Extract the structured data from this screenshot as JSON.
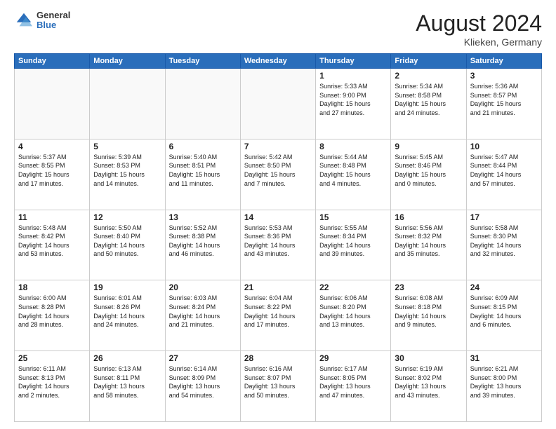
{
  "header": {
    "logo_general": "General",
    "logo_blue": "Blue",
    "month_title": "August 2024",
    "location": "Klieken, Germany"
  },
  "days_of_week": [
    "Sunday",
    "Monday",
    "Tuesday",
    "Wednesday",
    "Thursday",
    "Friday",
    "Saturday"
  ],
  "weeks": [
    [
      {
        "day": "",
        "text": ""
      },
      {
        "day": "",
        "text": ""
      },
      {
        "day": "",
        "text": ""
      },
      {
        "day": "",
        "text": ""
      },
      {
        "day": "1",
        "text": "Sunrise: 5:33 AM\nSunset: 9:00 PM\nDaylight: 15 hours\nand 27 minutes."
      },
      {
        "day": "2",
        "text": "Sunrise: 5:34 AM\nSunset: 8:58 PM\nDaylight: 15 hours\nand 24 minutes."
      },
      {
        "day": "3",
        "text": "Sunrise: 5:36 AM\nSunset: 8:57 PM\nDaylight: 15 hours\nand 21 minutes."
      }
    ],
    [
      {
        "day": "4",
        "text": "Sunrise: 5:37 AM\nSunset: 8:55 PM\nDaylight: 15 hours\nand 17 minutes."
      },
      {
        "day": "5",
        "text": "Sunrise: 5:39 AM\nSunset: 8:53 PM\nDaylight: 15 hours\nand 14 minutes."
      },
      {
        "day": "6",
        "text": "Sunrise: 5:40 AM\nSunset: 8:51 PM\nDaylight: 15 hours\nand 11 minutes."
      },
      {
        "day": "7",
        "text": "Sunrise: 5:42 AM\nSunset: 8:50 PM\nDaylight: 15 hours\nand 7 minutes."
      },
      {
        "day": "8",
        "text": "Sunrise: 5:44 AM\nSunset: 8:48 PM\nDaylight: 15 hours\nand 4 minutes."
      },
      {
        "day": "9",
        "text": "Sunrise: 5:45 AM\nSunset: 8:46 PM\nDaylight: 15 hours\nand 0 minutes."
      },
      {
        "day": "10",
        "text": "Sunrise: 5:47 AM\nSunset: 8:44 PM\nDaylight: 14 hours\nand 57 minutes."
      }
    ],
    [
      {
        "day": "11",
        "text": "Sunrise: 5:48 AM\nSunset: 8:42 PM\nDaylight: 14 hours\nand 53 minutes."
      },
      {
        "day": "12",
        "text": "Sunrise: 5:50 AM\nSunset: 8:40 PM\nDaylight: 14 hours\nand 50 minutes."
      },
      {
        "day": "13",
        "text": "Sunrise: 5:52 AM\nSunset: 8:38 PM\nDaylight: 14 hours\nand 46 minutes."
      },
      {
        "day": "14",
        "text": "Sunrise: 5:53 AM\nSunset: 8:36 PM\nDaylight: 14 hours\nand 43 minutes."
      },
      {
        "day": "15",
        "text": "Sunrise: 5:55 AM\nSunset: 8:34 PM\nDaylight: 14 hours\nand 39 minutes."
      },
      {
        "day": "16",
        "text": "Sunrise: 5:56 AM\nSunset: 8:32 PM\nDaylight: 14 hours\nand 35 minutes."
      },
      {
        "day": "17",
        "text": "Sunrise: 5:58 AM\nSunset: 8:30 PM\nDaylight: 14 hours\nand 32 minutes."
      }
    ],
    [
      {
        "day": "18",
        "text": "Sunrise: 6:00 AM\nSunset: 8:28 PM\nDaylight: 14 hours\nand 28 minutes."
      },
      {
        "day": "19",
        "text": "Sunrise: 6:01 AM\nSunset: 8:26 PM\nDaylight: 14 hours\nand 24 minutes."
      },
      {
        "day": "20",
        "text": "Sunrise: 6:03 AM\nSunset: 8:24 PM\nDaylight: 14 hours\nand 21 minutes."
      },
      {
        "day": "21",
        "text": "Sunrise: 6:04 AM\nSunset: 8:22 PM\nDaylight: 14 hours\nand 17 minutes."
      },
      {
        "day": "22",
        "text": "Sunrise: 6:06 AM\nSunset: 8:20 PM\nDaylight: 14 hours\nand 13 minutes."
      },
      {
        "day": "23",
        "text": "Sunrise: 6:08 AM\nSunset: 8:18 PM\nDaylight: 14 hours\nand 9 minutes."
      },
      {
        "day": "24",
        "text": "Sunrise: 6:09 AM\nSunset: 8:15 PM\nDaylight: 14 hours\nand 6 minutes."
      }
    ],
    [
      {
        "day": "25",
        "text": "Sunrise: 6:11 AM\nSunset: 8:13 PM\nDaylight: 14 hours\nand 2 minutes."
      },
      {
        "day": "26",
        "text": "Sunrise: 6:13 AM\nSunset: 8:11 PM\nDaylight: 13 hours\nand 58 minutes."
      },
      {
        "day": "27",
        "text": "Sunrise: 6:14 AM\nSunset: 8:09 PM\nDaylight: 13 hours\nand 54 minutes."
      },
      {
        "day": "28",
        "text": "Sunrise: 6:16 AM\nSunset: 8:07 PM\nDaylight: 13 hours\nand 50 minutes."
      },
      {
        "day": "29",
        "text": "Sunrise: 6:17 AM\nSunset: 8:05 PM\nDaylight: 13 hours\nand 47 minutes."
      },
      {
        "day": "30",
        "text": "Sunrise: 6:19 AM\nSunset: 8:02 PM\nDaylight: 13 hours\nand 43 minutes."
      },
      {
        "day": "31",
        "text": "Sunrise: 6:21 AM\nSunset: 8:00 PM\nDaylight: 13 hours\nand 39 minutes."
      }
    ]
  ]
}
